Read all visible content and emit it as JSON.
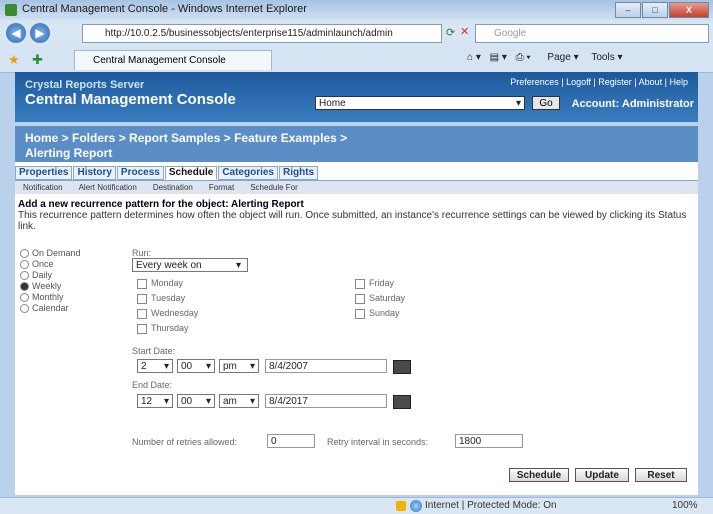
{
  "window": {
    "title": "Central Management Console - Windows Internet Explorer",
    "btn_min": "–",
    "btn_max": "□",
    "btn_close": "X"
  },
  "address": {
    "url": "http://10.0.2.5/businessobjects/enterprise115/adminlaunch/admin",
    "search_placeholder": "Google"
  },
  "tab": {
    "label": "Central Management Console"
  },
  "toolbar": {
    "page": "Page",
    "tools": "Tools"
  },
  "cms": {
    "subtitle": "Crystal Reports Server",
    "title": "Central Management Console",
    "links": "Preferences | Logoff | Register | About | Help",
    "home_select": "Home",
    "go": "Go",
    "account": "Account: Administrator"
  },
  "breadcrumb": {
    "line1": "Home > Folders > Report Samples > Feature Examples >",
    "line2": "Alerting Report"
  },
  "tabs": [
    "Properties",
    "History",
    "Process",
    "Schedule",
    "Categories",
    "Rights"
  ],
  "subtabs": [
    "Notification",
    "Alert Notification",
    "Destination",
    "Format",
    "Schedule For"
  ],
  "heading": "Add a new recurrence pattern for the object: Alerting Report",
  "description": "This recurrence pattern determines how often the object will run. Once submitted, an instance's recurrence settings can be viewed by clicking its Status link.",
  "recurrence": [
    "On Demand",
    "Once",
    "Daily",
    "Weekly",
    "Monthly",
    "Calendar"
  ],
  "run_label": "Run:",
  "run_value": "Every week on",
  "days_left": [
    "Monday",
    "Tuesday",
    "Wednesday",
    "Thursday"
  ],
  "days_right": [
    "Friday",
    "Saturday",
    "Sunday"
  ],
  "start": {
    "label": "Start Date:",
    "hour": "2",
    "min": "00",
    "ampm": "pm",
    "date": "8/4/2007"
  },
  "end": {
    "label": "End Date:",
    "hour": "12",
    "min": "00",
    "ampm": "am",
    "date": "8/4/2017"
  },
  "retries": {
    "label": "Number of retries allowed:",
    "value": "0"
  },
  "retry_interval": {
    "label": "Retry interval in seconds:",
    "value": "1800"
  },
  "buttons": {
    "schedule": "Schedule",
    "update": "Update",
    "reset": "Reset"
  },
  "status": {
    "zone": "Internet | Protected Mode: On",
    "zoom": "100%"
  }
}
